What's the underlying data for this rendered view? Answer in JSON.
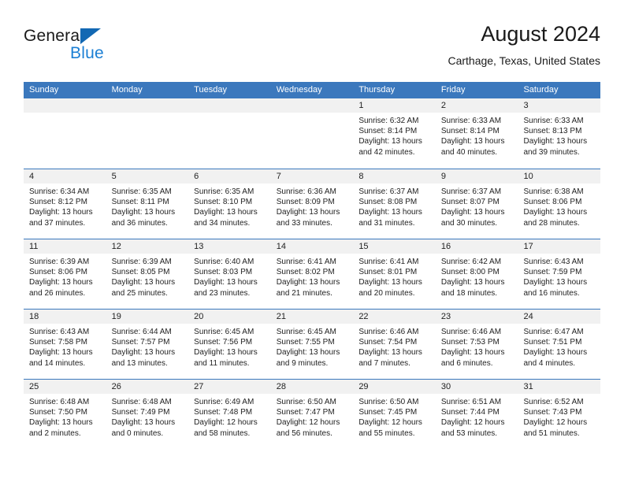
{
  "brand": {
    "word1": "General",
    "word2": "Blue",
    "triangle_color": "#1268b3",
    "blue_color": "#1b7fd4"
  },
  "header": {
    "title": "August 2024",
    "subtitle": "Carthage, Texas, United States"
  },
  "theme": {
    "header_bar": "#3b78bd",
    "daynum_strip": "#f1f1f1",
    "text": "#222222"
  },
  "calendar": {
    "day_headers": [
      "Sunday",
      "Monday",
      "Tuesday",
      "Wednesday",
      "Thursday",
      "Friday",
      "Saturday"
    ],
    "weeks": [
      [
        {
          "day": "",
          "sunrise": "",
          "sunset": "",
          "daylight1": "",
          "daylight2": "",
          "empty": true
        },
        {
          "day": "",
          "sunrise": "",
          "sunset": "",
          "daylight1": "",
          "daylight2": "",
          "empty": true
        },
        {
          "day": "",
          "sunrise": "",
          "sunset": "",
          "daylight1": "",
          "daylight2": "",
          "empty": true
        },
        {
          "day": "",
          "sunrise": "",
          "sunset": "",
          "daylight1": "",
          "daylight2": "",
          "empty": true
        },
        {
          "day": "1",
          "sunrise": "Sunrise: 6:32 AM",
          "sunset": "Sunset: 8:14 PM",
          "daylight1": "Daylight: 13 hours",
          "daylight2": "and 42 minutes."
        },
        {
          "day": "2",
          "sunrise": "Sunrise: 6:33 AM",
          "sunset": "Sunset: 8:14 PM",
          "daylight1": "Daylight: 13 hours",
          "daylight2": "and 40 minutes."
        },
        {
          "day": "3",
          "sunrise": "Sunrise: 6:33 AM",
          "sunset": "Sunset: 8:13 PM",
          "daylight1": "Daylight: 13 hours",
          "daylight2": "and 39 minutes."
        }
      ],
      [
        {
          "day": "4",
          "sunrise": "Sunrise: 6:34 AM",
          "sunset": "Sunset: 8:12 PM",
          "daylight1": "Daylight: 13 hours",
          "daylight2": "and 37 minutes."
        },
        {
          "day": "5",
          "sunrise": "Sunrise: 6:35 AM",
          "sunset": "Sunset: 8:11 PM",
          "daylight1": "Daylight: 13 hours",
          "daylight2": "and 36 minutes."
        },
        {
          "day": "6",
          "sunrise": "Sunrise: 6:35 AM",
          "sunset": "Sunset: 8:10 PM",
          "daylight1": "Daylight: 13 hours",
          "daylight2": "and 34 minutes."
        },
        {
          "day": "7",
          "sunrise": "Sunrise: 6:36 AM",
          "sunset": "Sunset: 8:09 PM",
          "daylight1": "Daylight: 13 hours",
          "daylight2": "and 33 minutes."
        },
        {
          "day": "8",
          "sunrise": "Sunrise: 6:37 AM",
          "sunset": "Sunset: 8:08 PM",
          "daylight1": "Daylight: 13 hours",
          "daylight2": "and 31 minutes."
        },
        {
          "day": "9",
          "sunrise": "Sunrise: 6:37 AM",
          "sunset": "Sunset: 8:07 PM",
          "daylight1": "Daylight: 13 hours",
          "daylight2": "and 30 minutes."
        },
        {
          "day": "10",
          "sunrise": "Sunrise: 6:38 AM",
          "sunset": "Sunset: 8:06 PM",
          "daylight1": "Daylight: 13 hours",
          "daylight2": "and 28 minutes."
        }
      ],
      [
        {
          "day": "11",
          "sunrise": "Sunrise: 6:39 AM",
          "sunset": "Sunset: 8:06 PM",
          "daylight1": "Daylight: 13 hours",
          "daylight2": "and 26 minutes."
        },
        {
          "day": "12",
          "sunrise": "Sunrise: 6:39 AM",
          "sunset": "Sunset: 8:05 PM",
          "daylight1": "Daylight: 13 hours",
          "daylight2": "and 25 minutes."
        },
        {
          "day": "13",
          "sunrise": "Sunrise: 6:40 AM",
          "sunset": "Sunset: 8:03 PM",
          "daylight1": "Daylight: 13 hours",
          "daylight2": "and 23 minutes."
        },
        {
          "day": "14",
          "sunrise": "Sunrise: 6:41 AM",
          "sunset": "Sunset: 8:02 PM",
          "daylight1": "Daylight: 13 hours",
          "daylight2": "and 21 minutes."
        },
        {
          "day": "15",
          "sunrise": "Sunrise: 6:41 AM",
          "sunset": "Sunset: 8:01 PM",
          "daylight1": "Daylight: 13 hours",
          "daylight2": "and 20 minutes."
        },
        {
          "day": "16",
          "sunrise": "Sunrise: 6:42 AM",
          "sunset": "Sunset: 8:00 PM",
          "daylight1": "Daylight: 13 hours",
          "daylight2": "and 18 minutes."
        },
        {
          "day": "17",
          "sunrise": "Sunrise: 6:43 AM",
          "sunset": "Sunset: 7:59 PM",
          "daylight1": "Daylight: 13 hours",
          "daylight2": "and 16 minutes."
        }
      ],
      [
        {
          "day": "18",
          "sunrise": "Sunrise: 6:43 AM",
          "sunset": "Sunset: 7:58 PM",
          "daylight1": "Daylight: 13 hours",
          "daylight2": "and 14 minutes."
        },
        {
          "day": "19",
          "sunrise": "Sunrise: 6:44 AM",
          "sunset": "Sunset: 7:57 PM",
          "daylight1": "Daylight: 13 hours",
          "daylight2": "and 13 minutes."
        },
        {
          "day": "20",
          "sunrise": "Sunrise: 6:45 AM",
          "sunset": "Sunset: 7:56 PM",
          "daylight1": "Daylight: 13 hours",
          "daylight2": "and 11 minutes."
        },
        {
          "day": "21",
          "sunrise": "Sunrise: 6:45 AM",
          "sunset": "Sunset: 7:55 PM",
          "daylight1": "Daylight: 13 hours",
          "daylight2": "and 9 minutes."
        },
        {
          "day": "22",
          "sunrise": "Sunrise: 6:46 AM",
          "sunset": "Sunset: 7:54 PM",
          "daylight1": "Daylight: 13 hours",
          "daylight2": "and 7 minutes."
        },
        {
          "day": "23",
          "sunrise": "Sunrise: 6:46 AM",
          "sunset": "Sunset: 7:53 PM",
          "daylight1": "Daylight: 13 hours",
          "daylight2": "and 6 minutes."
        },
        {
          "day": "24",
          "sunrise": "Sunrise: 6:47 AM",
          "sunset": "Sunset: 7:51 PM",
          "daylight1": "Daylight: 13 hours",
          "daylight2": "and 4 minutes."
        }
      ],
      [
        {
          "day": "25",
          "sunrise": "Sunrise: 6:48 AM",
          "sunset": "Sunset: 7:50 PM",
          "daylight1": "Daylight: 13 hours",
          "daylight2": "and 2 minutes."
        },
        {
          "day": "26",
          "sunrise": "Sunrise: 6:48 AM",
          "sunset": "Sunset: 7:49 PM",
          "daylight1": "Daylight: 13 hours",
          "daylight2": "and 0 minutes."
        },
        {
          "day": "27",
          "sunrise": "Sunrise: 6:49 AM",
          "sunset": "Sunset: 7:48 PM",
          "daylight1": "Daylight: 12 hours",
          "daylight2": "and 58 minutes."
        },
        {
          "day": "28",
          "sunrise": "Sunrise: 6:50 AM",
          "sunset": "Sunset: 7:47 PM",
          "daylight1": "Daylight: 12 hours",
          "daylight2": "and 56 minutes."
        },
        {
          "day": "29",
          "sunrise": "Sunrise: 6:50 AM",
          "sunset": "Sunset: 7:45 PM",
          "daylight1": "Daylight: 12 hours",
          "daylight2": "and 55 minutes."
        },
        {
          "day": "30",
          "sunrise": "Sunrise: 6:51 AM",
          "sunset": "Sunset: 7:44 PM",
          "daylight1": "Daylight: 12 hours",
          "daylight2": "and 53 minutes."
        },
        {
          "day": "31",
          "sunrise": "Sunrise: 6:52 AM",
          "sunset": "Sunset: 7:43 PM",
          "daylight1": "Daylight: 12 hours",
          "daylight2": "and 51 minutes."
        }
      ]
    ]
  }
}
